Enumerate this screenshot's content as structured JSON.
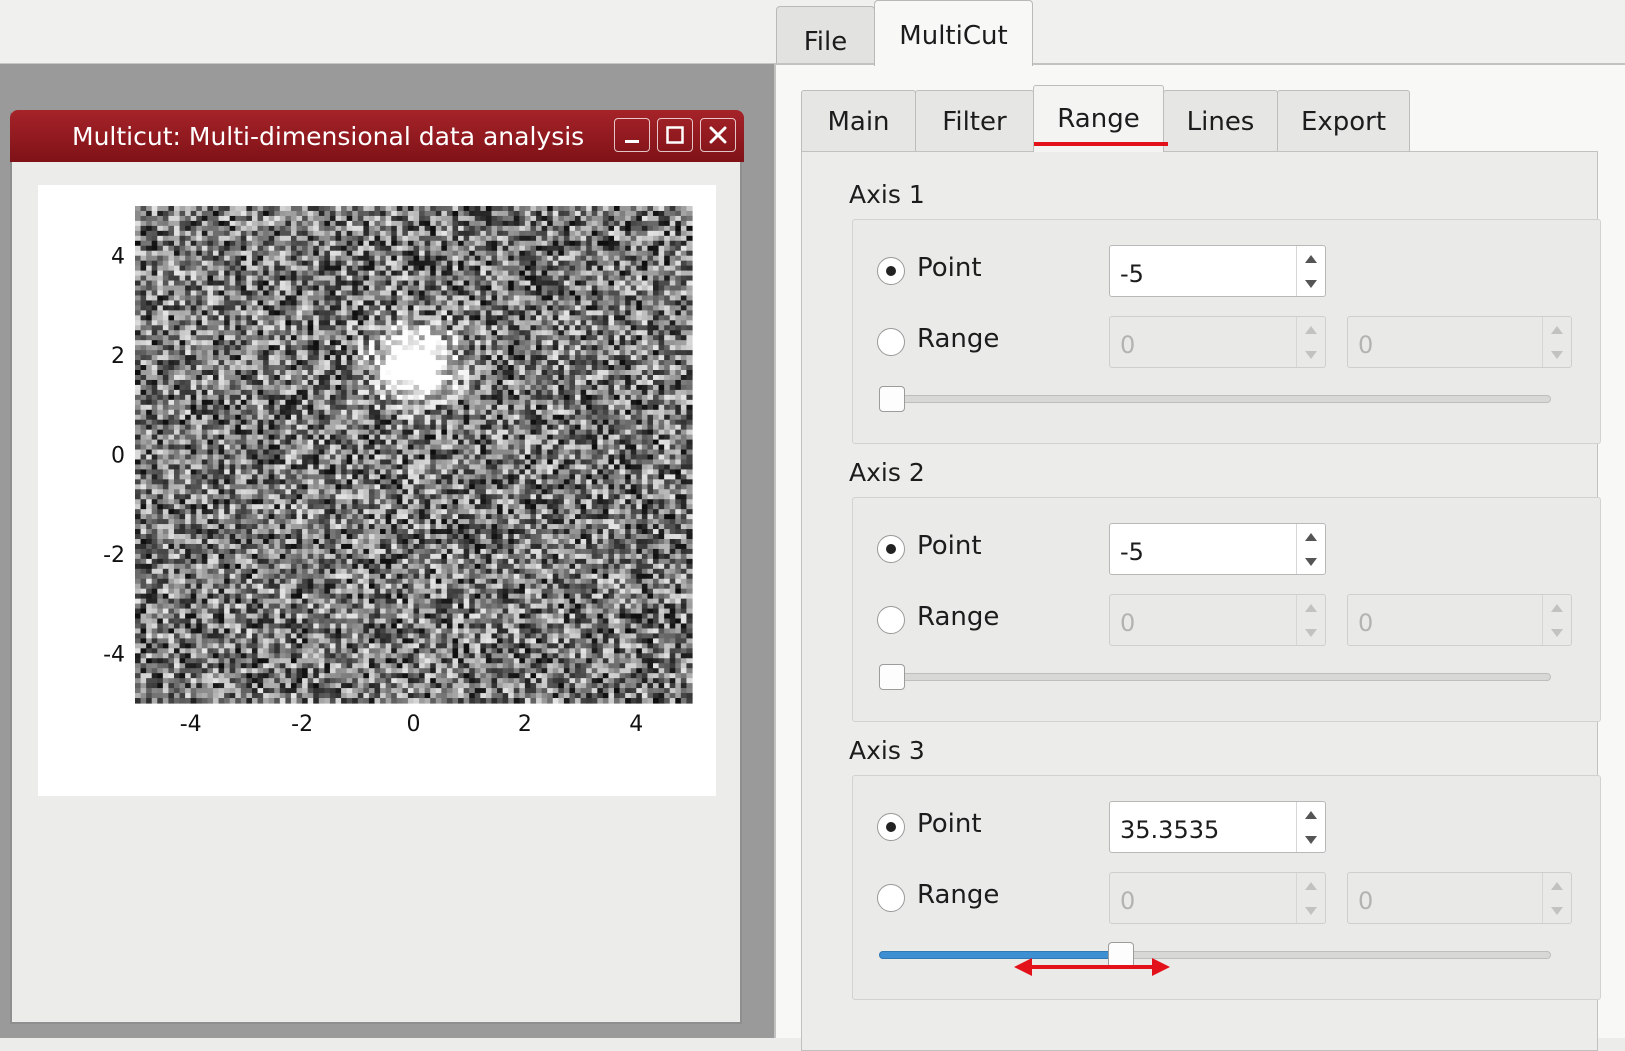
{
  "top_tabs": {
    "file": "File",
    "multicut": "MultiCut"
  },
  "window": {
    "title": "Multicut: Multi-dimensional data analysis"
  },
  "plot": {
    "x_ticks": [
      "-4",
      "-2",
      "0",
      "2",
      "4"
    ],
    "y_ticks": [
      "4",
      "2",
      "0",
      "-2",
      "-4"
    ],
    "colormap": "grayscale",
    "x_range": [
      -5,
      5
    ],
    "y_range": [
      -5,
      5
    ],
    "bright_spot_center": [
      0,
      1.8
    ]
  },
  "sub_tabs": {
    "main": "Main",
    "filter": "Filter",
    "range": "Range",
    "lines": "Lines",
    "export": "Export",
    "active": "Range"
  },
  "axes": [
    {
      "title": "Axis 1",
      "point_label": "Point",
      "range_label": "Range",
      "point_value": "-5",
      "range_min": "0",
      "range_max": "0",
      "selected": "point",
      "slider_fraction": 0.0
    },
    {
      "title": "Axis 2",
      "point_label": "Point",
      "range_label": "Range",
      "point_value": "-5",
      "range_min": "0",
      "range_max": "0",
      "selected": "point",
      "slider_fraction": 0.0
    },
    {
      "title": "Axis 3",
      "point_label": "Point",
      "range_label": "Range",
      "point_value": "35.3535",
      "range_min": "0",
      "range_max": "0",
      "selected": "point",
      "slider_fraction": 0.355
    }
  ],
  "colors": {
    "title_bar": "#8f1a1f",
    "active_tab_underline": "#e2111a",
    "slider_fill": "#3d8fd1",
    "annotation_arrow": "#e2111a"
  }
}
